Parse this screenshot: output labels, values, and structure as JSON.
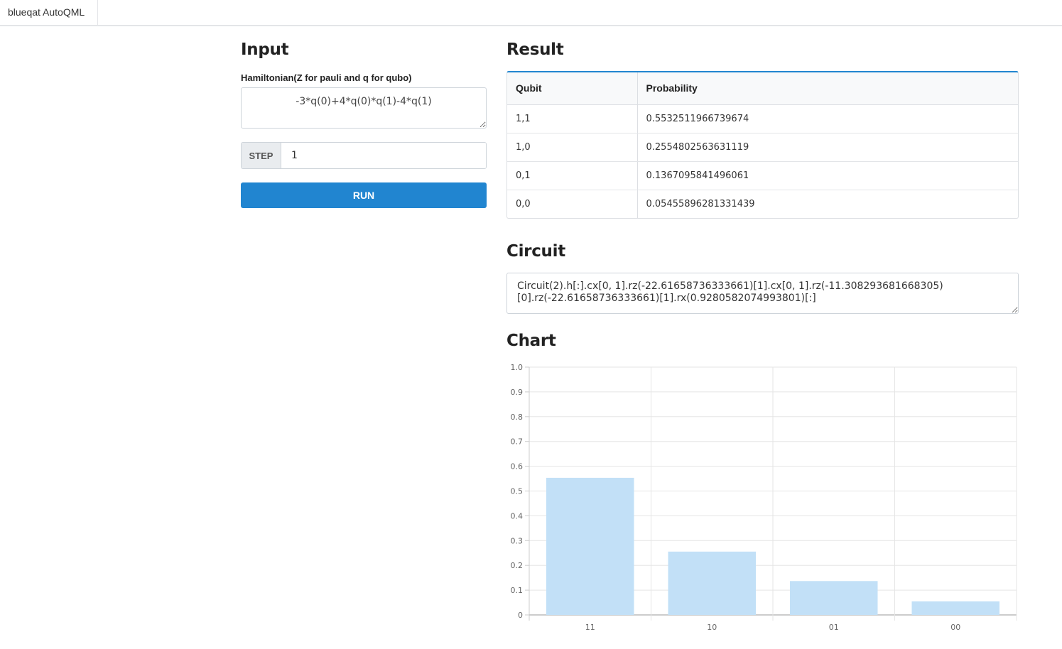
{
  "app": {
    "title": "blueqat AutoQML"
  },
  "input": {
    "heading": "Input",
    "hamiltonian_label": "Hamiltonian(Z for pauli and q for qubo)",
    "hamiltonian_value": "-3*q(0)+4*q(0)*q(1)-4*q(1)",
    "step_label": "STEP",
    "step_value": "1",
    "run_label": "RUN"
  },
  "result": {
    "heading": "Result",
    "columns": [
      "Qubit",
      "Probability"
    ],
    "rows": [
      {
        "qubit": "1,1",
        "probability": "0.5532511966739674"
      },
      {
        "qubit": "1,0",
        "probability": "0.2554802563631119"
      },
      {
        "qubit": "0,1",
        "probability": "0.1367095841496061"
      },
      {
        "qubit": "0,0",
        "probability": "0.05455896281331439"
      }
    ]
  },
  "circuit": {
    "heading": "Circuit",
    "value": "Circuit(2).h[:].cx[0, 1].rz(-22.61658736333661)[1].cx[0, 1].rz(-11.308293681668305)[0].rz(-22.61658736333661)[1].rx(0.9280582074993801)[:]"
  },
  "chart": {
    "heading": "Chart"
  },
  "colors": {
    "accent": "#2185d0",
    "bar": "#c2e0f7"
  },
  "chart_data": {
    "type": "bar",
    "categories": [
      "11",
      "10",
      "01",
      "00"
    ],
    "values": [
      0.5532511966739674,
      0.2554802563631119,
      0.1367095841496061,
      0.05455896281331439
    ],
    "ylim": [
      0,
      1.0
    ],
    "yticks": [
      "0",
      "0.1",
      "0.2",
      "0.3",
      "0.4",
      "0.5",
      "0.6",
      "0.7",
      "0.8",
      "0.9",
      "1.0"
    ],
    "grid": true,
    "title": "",
    "xlabel": "",
    "ylabel": ""
  }
}
